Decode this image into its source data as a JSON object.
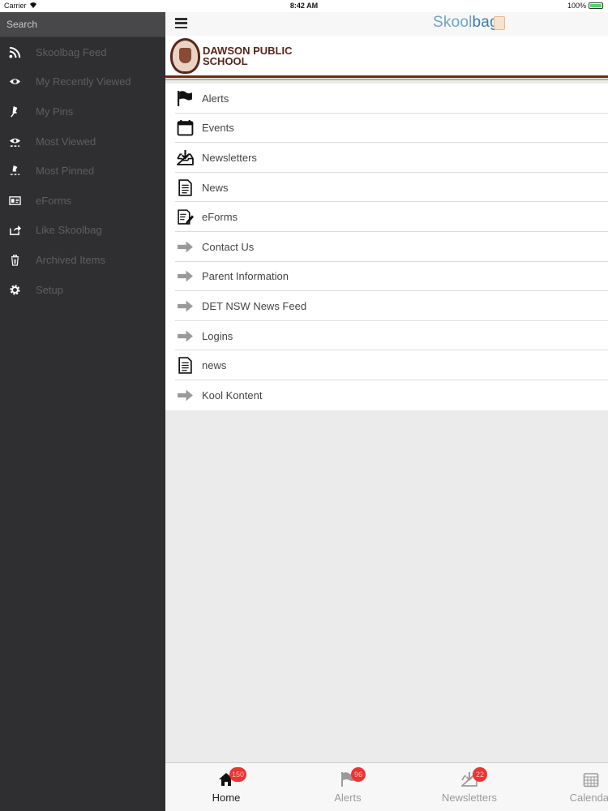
{
  "status_bar": {
    "carrier": "Carrier",
    "time": "8:42 AM",
    "battery": "100%"
  },
  "sidebar": {
    "search_placeholder": "Search",
    "items": [
      {
        "label": "Skoolbag Feed",
        "icon": "rss-icon"
      },
      {
        "label": "My Recently Viewed",
        "icon": "eye-icon"
      },
      {
        "label": "My Pins",
        "icon": "pin-icon"
      },
      {
        "label": "Most Viewed",
        "icon": "eye-group-icon"
      },
      {
        "label": "Most Pinned",
        "icon": "pin-group-icon"
      },
      {
        "label": "eForms",
        "icon": "id-card-icon"
      },
      {
        "label": "Like Skoolbag",
        "icon": "share-icon"
      },
      {
        "label": "Archived Items",
        "icon": "trash-icon"
      },
      {
        "label": "Setup",
        "icon": "gear-icon"
      }
    ]
  },
  "header": {
    "logo_main": "Skool",
    "logo_accent": "bag"
  },
  "school": {
    "name_line1": "DAWSON PUBLIC",
    "name_line2": "SCHOOL"
  },
  "menu": [
    {
      "label": "Alerts",
      "icon": "flag-icon"
    },
    {
      "label": "Events",
      "icon": "calendar-icon"
    },
    {
      "label": "Newsletters",
      "icon": "inbox-download-icon"
    },
    {
      "label": "News",
      "icon": "document-icon"
    },
    {
      "label": "eForms",
      "icon": "form-edit-icon"
    },
    {
      "label": "Contact Us",
      "icon": "arrow-right-icon"
    },
    {
      "label": "Parent Information",
      "icon": "arrow-right-icon"
    },
    {
      "label": "DET NSW News Feed",
      "icon": "arrow-right-icon"
    },
    {
      "label": "Logins",
      "icon": "arrow-right-icon"
    },
    {
      "label": "news",
      "icon": "document-icon"
    },
    {
      "label": "Kool Kontent",
      "icon": "arrow-right-icon"
    }
  ],
  "tabs": [
    {
      "label": "Home",
      "badge": "150",
      "icon": "home-icon",
      "active": true
    },
    {
      "label": "Alerts",
      "badge": "96",
      "icon": "flag-icon",
      "active": false
    },
    {
      "label": "Newsletters",
      "badge": "22",
      "icon": "inbox-download-icon",
      "active": false
    },
    {
      "label": "Calendar",
      "badge": "",
      "icon": "calendar-icon",
      "active": false
    }
  ],
  "colors": {
    "sidebar_bg": "#2f2f31",
    "school_brown": "#5a2518",
    "badge_red": "#e33333",
    "skoolbag_blue": "#3d7faa"
  }
}
